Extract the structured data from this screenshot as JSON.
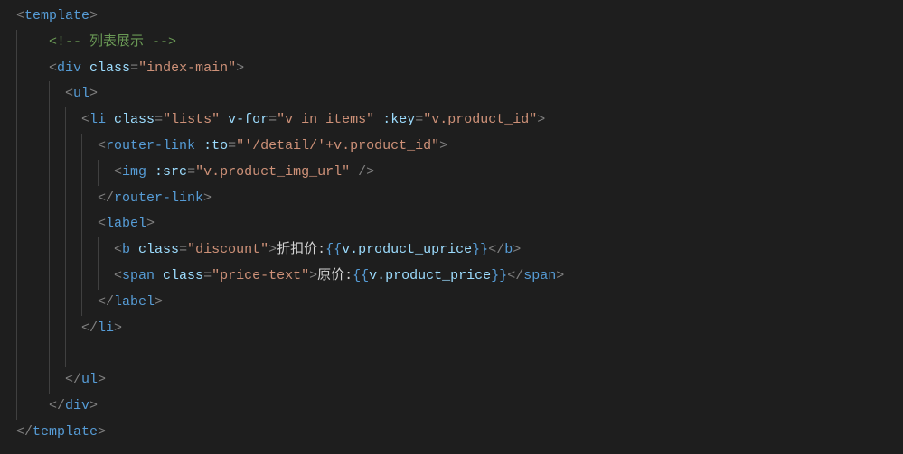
{
  "lines": [
    {
      "indent": 0,
      "guides": [],
      "tokens": [
        {
          "cls": "punct",
          "t": "<"
        },
        {
          "cls": "tag",
          "t": "template"
        },
        {
          "cls": "punct",
          "t": ">"
        }
      ]
    },
    {
      "indent": 2,
      "guides": [
        0,
        1
      ],
      "tokens": [
        {
          "cls": "comment",
          "t": "<!-- 列表展示 -->"
        }
      ]
    },
    {
      "indent": 2,
      "guides": [
        0,
        1
      ],
      "tokens": [
        {
          "cls": "punct",
          "t": "<"
        },
        {
          "cls": "tag",
          "t": "div"
        },
        {
          "cls": "text",
          "t": " "
        },
        {
          "cls": "attr",
          "t": "class"
        },
        {
          "cls": "punct",
          "t": "="
        },
        {
          "cls": "str",
          "t": "\"index-main\""
        },
        {
          "cls": "punct",
          "t": ">"
        }
      ]
    },
    {
      "indent": 3,
      "guides": [
        0,
        1,
        2
      ],
      "tokens": [
        {
          "cls": "punct",
          "t": "<"
        },
        {
          "cls": "tag",
          "t": "ul"
        },
        {
          "cls": "punct",
          "t": ">"
        }
      ]
    },
    {
      "indent": 4,
      "guides": [
        0,
        1,
        2,
        3
      ],
      "tokens": [
        {
          "cls": "punct",
          "t": "<"
        },
        {
          "cls": "tag",
          "t": "li"
        },
        {
          "cls": "text",
          "t": " "
        },
        {
          "cls": "attr",
          "t": "class"
        },
        {
          "cls": "punct",
          "t": "="
        },
        {
          "cls": "str",
          "t": "\"lists\""
        },
        {
          "cls": "text",
          "t": " "
        },
        {
          "cls": "attr",
          "t": "v-for"
        },
        {
          "cls": "punct",
          "t": "="
        },
        {
          "cls": "str",
          "t": "\"v in items\""
        },
        {
          "cls": "text",
          "t": " "
        },
        {
          "cls": "attr",
          "t": ":key"
        },
        {
          "cls": "punct",
          "t": "="
        },
        {
          "cls": "str",
          "t": "\"v.product_id\""
        },
        {
          "cls": "punct",
          "t": ">"
        }
      ]
    },
    {
      "indent": 5,
      "guides": [
        0,
        1,
        2,
        3,
        4
      ],
      "tokens": [
        {
          "cls": "punct",
          "t": "<"
        },
        {
          "cls": "tag",
          "t": "router-link"
        },
        {
          "cls": "text",
          "t": " "
        },
        {
          "cls": "attr",
          "t": ":to"
        },
        {
          "cls": "punct",
          "t": "="
        },
        {
          "cls": "str",
          "t": "\"'/detail/'+v.product_id\""
        },
        {
          "cls": "punct",
          "t": ">"
        }
      ]
    },
    {
      "indent": 6,
      "guides": [
        0,
        1,
        2,
        3,
        4,
        5
      ],
      "tokens": [
        {
          "cls": "punct",
          "t": "<"
        },
        {
          "cls": "tag",
          "t": "img"
        },
        {
          "cls": "text",
          "t": " "
        },
        {
          "cls": "attr",
          "t": ":src"
        },
        {
          "cls": "punct",
          "t": "="
        },
        {
          "cls": "str",
          "t": "\"v.product_img_url\""
        },
        {
          "cls": "text",
          "t": " "
        },
        {
          "cls": "punct",
          "t": "/>"
        }
      ]
    },
    {
      "indent": 5,
      "guides": [
        0,
        1,
        2,
        3,
        4
      ],
      "tokens": [
        {
          "cls": "punct",
          "t": "</"
        },
        {
          "cls": "tag",
          "t": "router-link"
        },
        {
          "cls": "punct",
          "t": ">"
        }
      ]
    },
    {
      "indent": 5,
      "guides": [
        0,
        1,
        2,
        3,
        4
      ],
      "tokens": [
        {
          "cls": "punct",
          "t": "<"
        },
        {
          "cls": "tag",
          "t": "label"
        },
        {
          "cls": "punct",
          "t": ">"
        }
      ]
    },
    {
      "indent": 6,
      "guides": [
        0,
        1,
        2,
        3,
        4,
        5
      ],
      "tokens": [
        {
          "cls": "punct",
          "t": "<"
        },
        {
          "cls": "tag",
          "t": "b"
        },
        {
          "cls": "text",
          "t": " "
        },
        {
          "cls": "attr",
          "t": "class"
        },
        {
          "cls": "punct",
          "t": "="
        },
        {
          "cls": "str",
          "t": "\"discount\""
        },
        {
          "cls": "punct",
          "t": ">"
        },
        {
          "cls": "text",
          "t": "折扣价:"
        },
        {
          "cls": "brace",
          "t": "{{"
        },
        {
          "cls": "mustache",
          "t": "v.product_uprice"
        },
        {
          "cls": "brace",
          "t": "}}"
        },
        {
          "cls": "punct",
          "t": "</"
        },
        {
          "cls": "tag",
          "t": "b"
        },
        {
          "cls": "punct",
          "t": ">"
        }
      ]
    },
    {
      "indent": 6,
      "guides": [
        0,
        1,
        2,
        3,
        4,
        5
      ],
      "tokens": [
        {
          "cls": "punct",
          "t": "<"
        },
        {
          "cls": "tag",
          "t": "span"
        },
        {
          "cls": "text",
          "t": " "
        },
        {
          "cls": "attr",
          "t": "class"
        },
        {
          "cls": "punct",
          "t": "="
        },
        {
          "cls": "str",
          "t": "\"price-text\""
        },
        {
          "cls": "punct",
          "t": ">"
        },
        {
          "cls": "text",
          "t": "原价:"
        },
        {
          "cls": "brace",
          "t": "{{"
        },
        {
          "cls": "mustache",
          "t": "v.product_price"
        },
        {
          "cls": "brace",
          "t": "}}"
        },
        {
          "cls": "punct",
          "t": "</"
        },
        {
          "cls": "tag",
          "t": "span"
        },
        {
          "cls": "punct",
          "t": ">"
        }
      ]
    },
    {
      "indent": 5,
      "guides": [
        0,
        1,
        2,
        3,
        4
      ],
      "tokens": [
        {
          "cls": "punct",
          "t": "</"
        },
        {
          "cls": "tag",
          "t": "label"
        },
        {
          "cls": "punct",
          "t": ">"
        }
      ]
    },
    {
      "indent": 4,
      "guides": [
        0,
        1,
        2,
        3
      ],
      "tokens": [
        {
          "cls": "punct",
          "t": "</"
        },
        {
          "cls": "tag",
          "t": "li"
        },
        {
          "cls": "punct",
          "t": ">"
        }
      ]
    },
    {
      "indent": 4,
      "guides": [
        0,
        1,
        2,
        3
      ],
      "tokens": []
    },
    {
      "indent": 3,
      "guides": [
        0,
        1,
        2
      ],
      "tokens": [
        {
          "cls": "punct",
          "t": "</"
        },
        {
          "cls": "tag",
          "t": "ul"
        },
        {
          "cls": "punct",
          "t": ">"
        }
      ]
    },
    {
      "indent": 2,
      "guides": [
        0,
        1
      ],
      "tokens": [
        {
          "cls": "punct",
          "t": "</"
        },
        {
          "cls": "tag",
          "t": "div"
        },
        {
          "cls": "punct",
          "t": ">"
        }
      ]
    },
    {
      "indent": 0,
      "guides": [],
      "tokens": [
        {
          "cls": "punct",
          "t": "</"
        },
        {
          "cls": "tag",
          "t": "template"
        },
        {
          "cls": "punct",
          "t": ">"
        }
      ]
    }
  ],
  "indentUnitPx": 18,
  "guideUnitPx": 18
}
